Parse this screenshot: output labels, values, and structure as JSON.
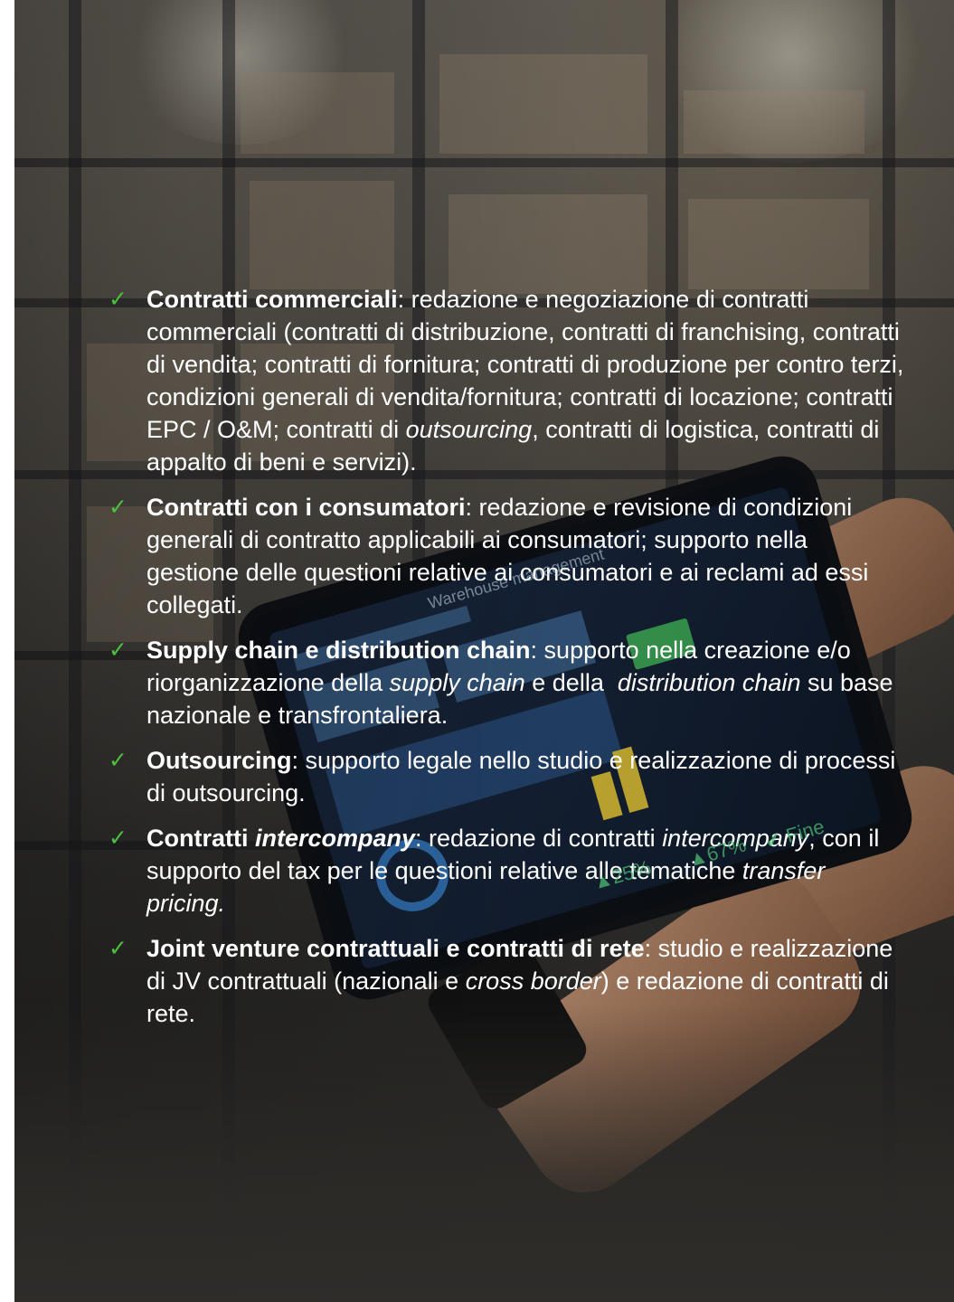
{
  "colors": {
    "check": "#4cc13e",
    "text": "#ffffff"
  },
  "icons": {
    "bullet": "check-icon"
  },
  "items": [
    {
      "check": "✓",
      "title": "Contratti commerciali",
      "p1": ": redazione e negoziazione di contratti commerciali (contratti di distribuzione, contratti di franchising, contratti di vendita; contratti di fornitura; contratti di produzione per contro terzi, condizioni generali di vendita/fornitura; contratti di locazione; contratti EPC / O&M; contratti di ",
      "i1": "outsourcing",
      "p2": ", contratti di logistica, contratti di appalto di beni e servizi)."
    },
    {
      "check": "✓",
      "title": "Contratti con i consumatori",
      "p1": ": redazione e revisione di condizioni generali di contratto applicabili ai consumatori; supporto nella gestione delle questioni relative ai consumatori e ai reclami ad essi collegati."
    },
    {
      "check": "✓",
      "title": "Supply chain e distribution chain",
      "p1": ": supporto nella creazione e/o riorganizzazione della ",
      "i1": "supply chain",
      "p2": " e della  ",
      "i2": "distribution chain",
      "p3": " su base nazionale e transfrontaliera."
    },
    {
      "check": "✓",
      "title": "Outsourcing",
      "p1": ": supporto legale nello studio e realizzazione di processi di outsourcing."
    },
    {
      "check": "✓",
      "title_a": "Contratti ",
      "title_i": "intercompany",
      "p1": ": redazione di contratti ",
      "i1": "intercompany",
      "p2": ", con il supporto del tax per le questioni relative alle tematiche ",
      "i2": "transfer pricing."
    },
    {
      "check": "✓",
      "title": "Joint venture contrattuali e contratti di rete",
      "p1": ": studio e realizzazione di JV contrattuali (nazionali e ",
      "i1": "cross border",
      "p2": ") e redazione di contratti di rete."
    }
  ],
  "screen": {
    "header": "Warehouse management",
    "stat1": "▲25%",
    "stat2": "▲67%",
    "stat3": "✔ Fine"
  }
}
